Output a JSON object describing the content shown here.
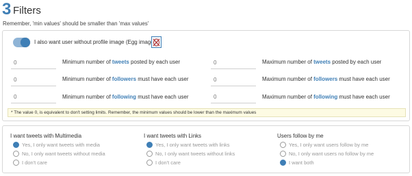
{
  "header": {
    "number": "3",
    "title": "Filters",
    "subtitle": "Remember, 'min values' should be smaller than 'max values'"
  },
  "profile_toggle": {
    "label": "I also want user without profile image (Egg image)",
    "on": true
  },
  "min_rows": [
    {
      "prefix": "Minimum number of ",
      "keyword": "tweets",
      "suffix": " posted by each user",
      "value": "0"
    },
    {
      "prefix": "Minimum number of ",
      "keyword": "followers",
      "suffix": " must have each user",
      "value": "0"
    },
    {
      "prefix": "Minimum number of ",
      "keyword": "following",
      "suffix": " must have each user",
      "value": "0"
    }
  ],
  "max_rows": [
    {
      "prefix": "Maximum number of ",
      "keyword": "tweets",
      "suffix": " posted by each user",
      "value": "0"
    },
    {
      "prefix": "Maximum number of ",
      "keyword": "followers",
      "suffix": " must have each user",
      "value": "0"
    },
    {
      "prefix": "Maximum number of ",
      "keyword": "following",
      "suffix": " must have each user",
      "value": "0"
    }
  ],
  "note": "* The value 0, is equivalent to don't setting limits. Remember, the minimum values should be lower than the maximum values",
  "groups": [
    {
      "title": "I want tweets with Multimedia",
      "options": [
        {
          "label": "Yes, I only want tweets with media",
          "checked": true
        },
        {
          "label": "No, I only want tweets without media",
          "checked": false
        },
        {
          "label": "I don't care",
          "checked": false
        }
      ]
    },
    {
      "title": "I want tweets with Links",
      "options": [
        {
          "label": "Yes, I only want tweets with links",
          "checked": true
        },
        {
          "label": "No, I only want tweets without links",
          "checked": false
        },
        {
          "label": "I don't care",
          "checked": false
        }
      ]
    },
    {
      "title": "Users follow by me",
      "options": [
        {
          "label": "Yes, I only want users follow by me",
          "checked": false
        },
        {
          "label": "No, I only want users no follow by me",
          "checked": false
        },
        {
          "label": "I want both",
          "checked": true
        }
      ]
    }
  ],
  "colors": {
    "accent": "#3f7fb6",
    "note_bg": "#fdfbe3",
    "muted": "#999999"
  },
  "icons": {
    "egg": "no-image-icon"
  }
}
